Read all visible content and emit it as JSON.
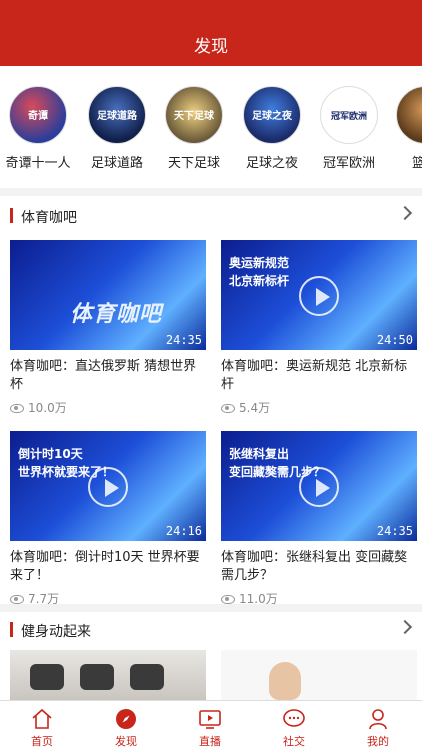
{
  "header": {
    "title": "发现"
  },
  "channels": [
    {
      "name": "奇谭十一人",
      "logo_text": "奇谭",
      "color": "#2b3e9a"
    },
    {
      "name": "足球道路",
      "logo_text": "足球道路",
      "color": "#1f3a7a"
    },
    {
      "name": "天下足球",
      "logo_text": "天下足球",
      "color": "#6a5a3a"
    },
    {
      "name": "足球之夜",
      "logo_text": "足球之夜",
      "color": "#1c2b6b"
    },
    {
      "name": "冠军欧洲",
      "logo_text": "冠军欧洲",
      "color": "#ffffff"
    },
    {
      "name": "篮球",
      "logo_text": "",
      "color": "#8a5a2a"
    }
  ],
  "sections": [
    {
      "title": "体育咖吧",
      "videos": [
        {
          "title": "体育咖吧：直达俄罗斯 猜想世界杯",
          "views": "10.0万",
          "duration": "24:35",
          "caption": ""
        },
        {
          "title": "体育咖吧：奥运新规范 北京新标杆",
          "views": "5.4万",
          "duration": "24:50",
          "caption": "奥运新规范\n北京新标杆"
        },
        {
          "title": "体育咖吧：倒计时10天 世界杯要来了！",
          "views": "7.7万",
          "duration": "24:16",
          "caption": "倒计时10天\n世界杯就要来了！"
        },
        {
          "title": "体育咖吧：张继科复出 变回藏獒需几步？",
          "views": "11.0万",
          "duration": "24:35",
          "caption": "张继科复出\n变回藏獒需几步？"
        }
      ]
    },
    {
      "title": "健身动起来"
    }
  ],
  "tabs": [
    {
      "label": "首页",
      "icon": "home-icon",
      "active": false
    },
    {
      "label": "发现",
      "icon": "compass-icon",
      "active": true
    },
    {
      "label": "直播",
      "icon": "tv-icon",
      "active": false
    },
    {
      "label": "社交",
      "icon": "chat-icon",
      "active": false
    },
    {
      "label": "我的",
      "icon": "user-icon",
      "active": false
    }
  ],
  "colors": {
    "brand": "#c8251b"
  }
}
